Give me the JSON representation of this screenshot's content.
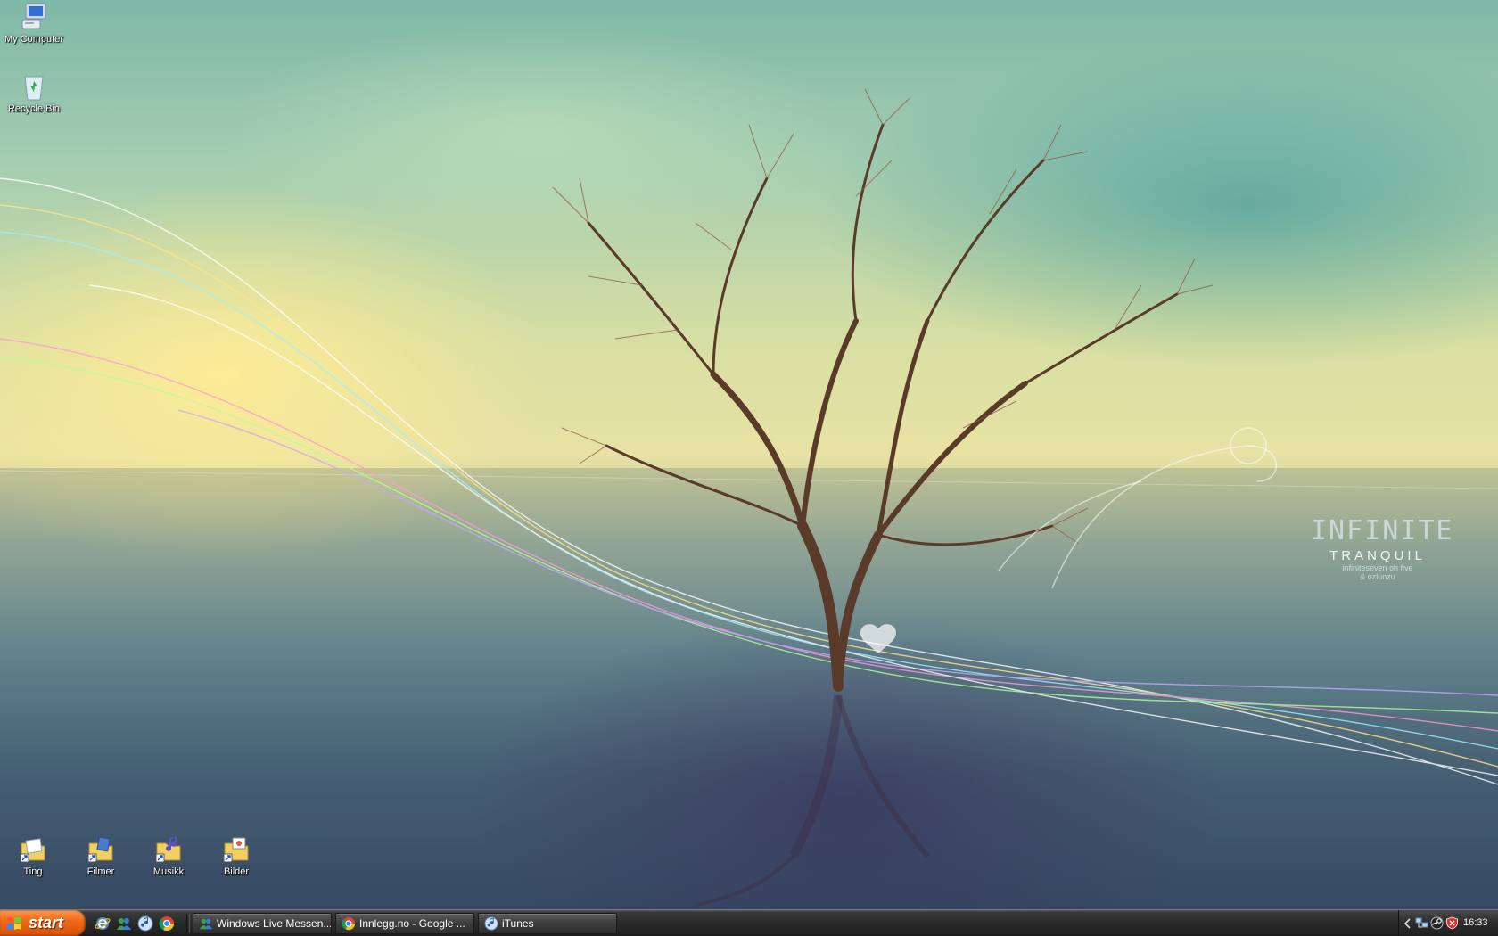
{
  "desktop": {
    "icons_top": [
      {
        "label": "My Computer",
        "icon": "computer-icon"
      },
      {
        "label": "Recycle Bin",
        "icon": "recycle-bin-icon"
      }
    ],
    "icons_bottom": [
      {
        "label": "Ting",
        "icon": "folder-shortcut-icon"
      },
      {
        "label": "Filmer",
        "icon": "folder-shortcut-icon"
      },
      {
        "label": "Musikk",
        "icon": "music-folder-shortcut-icon"
      },
      {
        "label": "Bilder",
        "icon": "pictures-folder-shortcut-icon"
      }
    ]
  },
  "wallpaper": {
    "logo_text": "INFINITE",
    "title": "TRANQUIL",
    "credit_line1": "infiniteseven oh five",
    "credit_line2": "& ozlunzu"
  },
  "taskbar": {
    "start_label": "start",
    "quick_launch": [
      "ie-icon",
      "messenger-icon",
      "itunes-icon",
      "chrome-icon"
    ],
    "tasks": [
      {
        "label": "Windows Live Messen...",
        "icon": "messenger-icon"
      },
      {
        "label": "Innlegg.no - Google ...",
        "icon": "chrome-icon"
      },
      {
        "label": "iTunes",
        "icon": "itunes-icon"
      }
    ],
    "tray": {
      "icons": [
        "network-icon",
        "steam-icon",
        "security-alert-icon"
      ],
      "clock": "16:33"
    }
  },
  "colors": {
    "start_button": "#f06a16",
    "taskbar": "#2a2a2a"
  }
}
